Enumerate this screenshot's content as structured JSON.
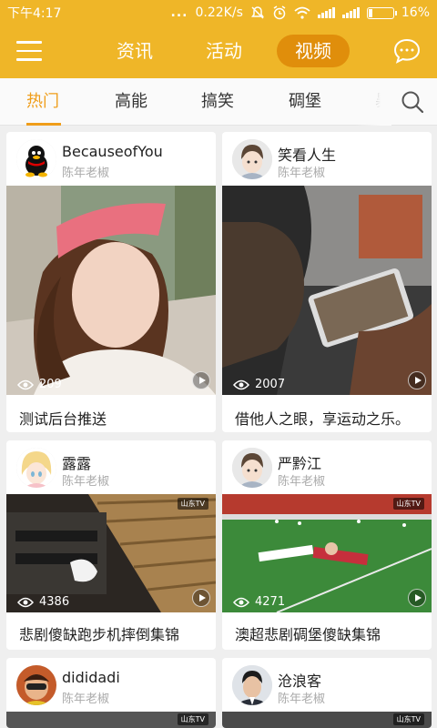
{
  "status_bar": {
    "time": "下午4:17",
    "dots": "...",
    "speed": "0.22K/s",
    "battery": "16%",
    "battery_level": 0.16
  },
  "top_nav": {
    "tabs": [
      {
        "label": "资讯",
        "active": false
      },
      {
        "label": "活动",
        "active": false
      },
      {
        "label": "视频",
        "active": true
      }
    ]
  },
  "categories": [
    {
      "label": "热门",
      "active": true
    },
    {
      "label": "高能",
      "active": false
    },
    {
      "label": "搞笑",
      "active": false
    },
    {
      "label": "碉堡",
      "active": false
    },
    {
      "label": "暴",
      "active": false
    }
  ],
  "feed": [
    {
      "user": "BecauseofYou",
      "sub": "陈年老椒",
      "views": "209",
      "title": "测试后台推送"
    },
    {
      "user": "笑看人生",
      "sub": "陈年老椒",
      "views": "2007",
      "title": "借他人之眼，享运动之乐。"
    },
    {
      "user": "露露",
      "sub": "陈年老椒",
      "views": "4386",
      "title": "悲剧傻缺跑步机摔倒集锦",
      "watermark": "山东TV"
    },
    {
      "user": "严黔江",
      "sub": "陈年老椒",
      "views": "4271",
      "title": "澳超悲剧碉堡傻缺集锦",
      "watermark": "山东TV"
    },
    {
      "user": "dididadi",
      "sub": "陈年老椒",
      "watermark": "山东TV"
    },
    {
      "user": "沧浪客",
      "sub": "陈年老椒",
      "watermark": "山东TV"
    }
  ],
  "colors": {
    "brand": "#efb628",
    "active_pill": "#e08e0b",
    "active_tab": "#ef9d1a"
  }
}
